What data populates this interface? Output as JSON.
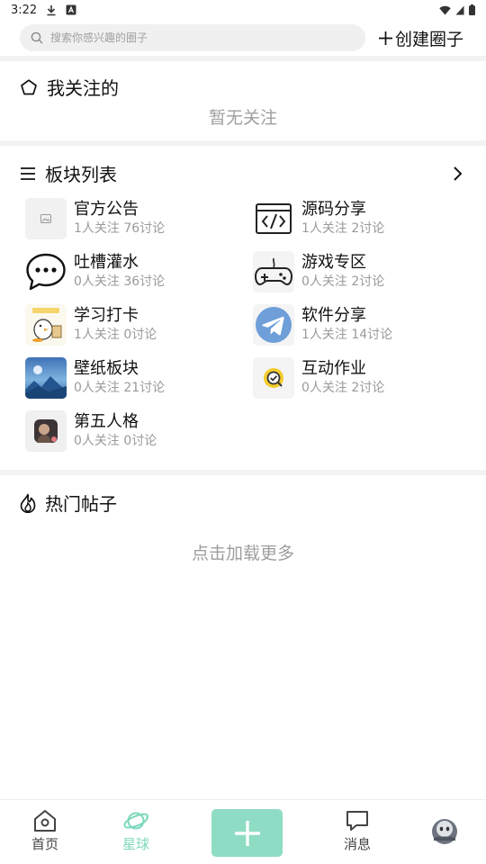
{
  "status_bar": {
    "time": "3:22"
  },
  "search": {
    "placeholder": "搜索你感兴趣的圈子"
  },
  "create": {
    "label": "创建圈子"
  },
  "following": {
    "title": "我关注的",
    "empty_text": "暂无关注"
  },
  "boards": {
    "title": "板块列表",
    "items": [
      {
        "name": "官方公告",
        "stats": "1人关注 76讨论",
        "icon": "image-placeholder-icon"
      },
      {
        "name": "源码分享",
        "stats": "1人关注 2讨论",
        "icon": "code-icon"
      },
      {
        "name": "吐槽灌水",
        "stats": "0人关注 36讨论",
        "icon": "chat-bubble-icon"
      },
      {
        "name": "游戏专区",
        "stats": "0人关注 2讨论",
        "icon": "gamepad-icon"
      },
      {
        "name": "学习打卡",
        "stats": "1人关注 0讨论",
        "icon": "study-duck-icon"
      },
      {
        "name": "软件分享",
        "stats": "1人关注 14讨论",
        "icon": "telegram-icon"
      },
      {
        "name": "壁纸板块",
        "stats": "0人关注 21讨论",
        "icon": "wallpaper-thumbnail-icon"
      },
      {
        "name": "互动作业",
        "stats": "0人关注 2讨论",
        "icon": "homework-check-icon"
      },
      {
        "name": "第五人格",
        "stats": "0人关注 0讨论",
        "icon": "identity-v-thumbnail-icon"
      }
    ]
  },
  "hot_posts": {
    "title": "热门帖子",
    "load_more": "点击加载更多"
  },
  "bottom_nav": {
    "home": "首页",
    "planet": "星球",
    "messages": "消息",
    "active_color": "#7dd8bd",
    "add_button_color": "#8edcc3"
  }
}
